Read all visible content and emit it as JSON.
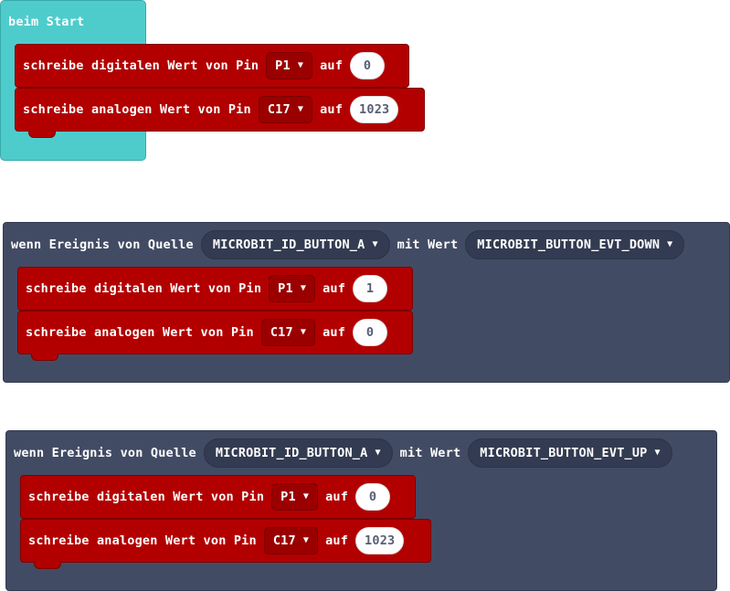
{
  "start": {
    "label": "beim Start",
    "blocks": [
      {
        "text": "schreibe digitalen Wert von Pin",
        "pin": "P1",
        "auf": "auf",
        "value": "0"
      },
      {
        "text": "schreibe analogen Wert von Pin",
        "pin": "C17",
        "auf": "auf",
        "value": "1023"
      }
    ]
  },
  "events": [
    {
      "label": "wenn Ereignis von Quelle",
      "source": "MICROBIT_ID_BUTTON_A",
      "with_label": "mit Wert",
      "value": "MICROBIT_BUTTON_EVT_DOWN",
      "blocks": [
        {
          "text": "schreibe digitalen Wert von Pin",
          "pin": "P1",
          "auf": "auf",
          "value": "1"
        },
        {
          "text": "schreibe analogen Wert von Pin",
          "pin": "C17",
          "auf": "auf",
          "value": "0"
        }
      ]
    },
    {
      "label": "wenn Ereignis von Quelle",
      "source": "MICROBIT_ID_BUTTON_A",
      "with_label": "mit Wert",
      "value": "MICROBIT_BUTTON_EVT_UP",
      "blocks": [
        {
          "text": "schreibe digitalen Wert von Pin",
          "pin": "P1",
          "auf": "auf",
          "value": "0"
        },
        {
          "text": "schreibe analogen Wert von Pin",
          "pin": "C17",
          "auf": "auf",
          "value": "1023"
        }
      ]
    }
  ],
  "colors": {
    "start_block": "#4ecccc",
    "event_block": "#424b64",
    "pins_block": "#b20000"
  },
  "icons": {
    "dropdown": "chevron-down-icon"
  }
}
